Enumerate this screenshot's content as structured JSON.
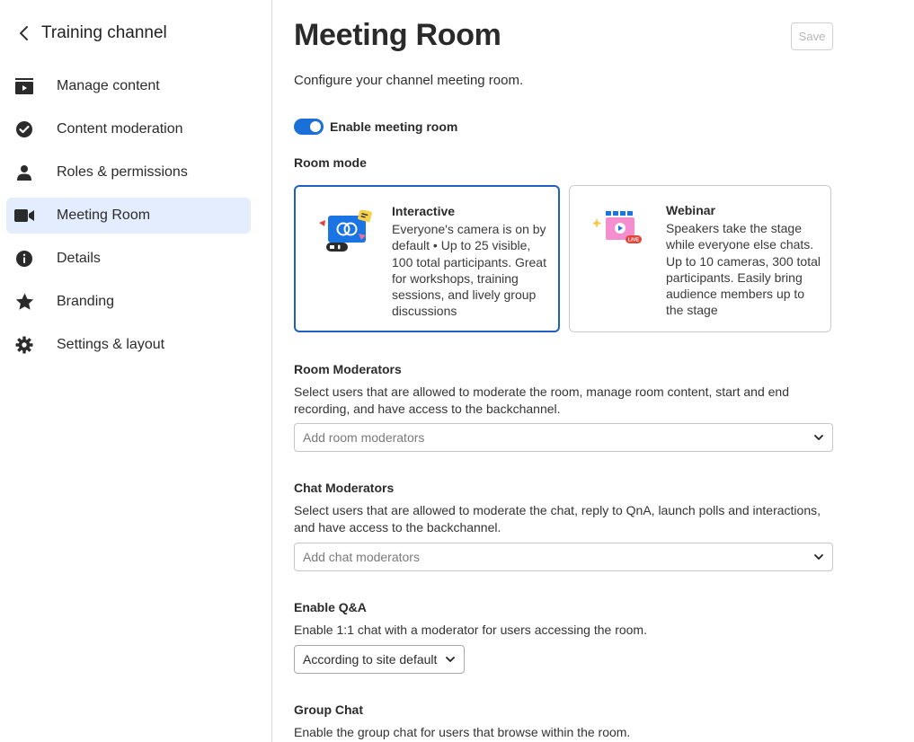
{
  "sidebar": {
    "back_title": "Training channel",
    "items": [
      {
        "label": "Manage content",
        "icon": "play-box-icon",
        "active": false
      },
      {
        "label": "Content moderation",
        "icon": "check-circle-icon",
        "active": false
      },
      {
        "label": "Roles & permissions",
        "icon": "person-icon",
        "active": false
      },
      {
        "label": "Meeting Room",
        "icon": "video-camera-icon",
        "active": true
      },
      {
        "label": "Details",
        "icon": "info-icon",
        "active": false
      },
      {
        "label": "Branding",
        "icon": "star-icon",
        "active": false
      },
      {
        "label": "Settings & layout",
        "icon": "gear-icon",
        "active": false
      }
    ]
  },
  "main": {
    "title": "Meeting Room",
    "save_label": "Save",
    "subtitle": "Configure your channel meeting room.",
    "enable_toggle": {
      "label": "Enable meeting room",
      "on": true
    },
    "room_mode": {
      "label": "Room mode",
      "options": [
        {
          "title": "Interactive",
          "text": "Everyone's camera is on by default • Up to 25 visible, 100 total participants. Great for workshops, training sessions, and lively group discussions",
          "selected": true
        },
        {
          "title": "Webinar",
          "text": "Speakers take the stage while everyone else chats. Up to 10 cameras, 300 total participants. Easily bring audience members up to the stage",
          "selected": false
        }
      ]
    },
    "room_moderators": {
      "label": "Room Moderators",
      "desc": "Select users that are allowed to moderate the room, manage room content, start and end recording, and have access to the backchannel.",
      "placeholder": "Add room moderators"
    },
    "chat_moderators": {
      "label": "Chat Moderators",
      "desc": "Select users that are allowed to moderate the chat, reply to QnA, launch polls and interactions, and have access to the backchannel.",
      "placeholder": "Add chat moderators"
    },
    "qna": {
      "label": "Enable Q&A",
      "desc": "Enable 1:1 chat with a moderator for users accessing the room.",
      "value": "According to site default"
    },
    "group_chat": {
      "label": "Group Chat",
      "desc": "Enable the group chat for users that browse within the room."
    }
  },
  "colors": {
    "accent": "#1b6fd8",
    "active_nav_bg": "#e3edfd",
    "selected_card_border": "#1f5fbf"
  }
}
